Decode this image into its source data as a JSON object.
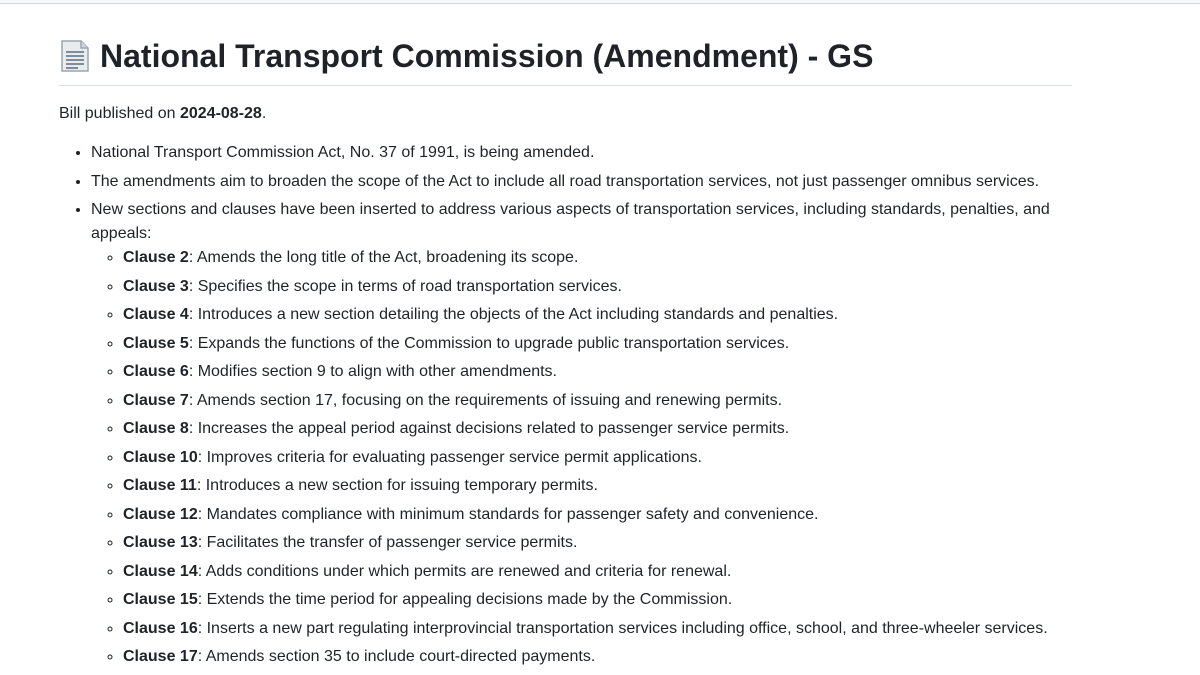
{
  "title": "National Transport Commission (Amendment) - GS",
  "title_icon": "document-icon",
  "published": {
    "prefix": "Bill published on ",
    "date": "2024-08-28",
    "suffix": "."
  },
  "points": [
    "National Transport Commission Act, No. 37 of 1991, is being amended.",
    "The amendments aim to broaden the scope of the Act to include all road transportation services, not just passenger omnibus services.",
    "New sections and clauses have been inserted to address various aspects of transportation services, including standards, penalties, and appeals:"
  ],
  "clauses": [
    {
      "label": "Clause 2",
      "text": ": Amends the long title of the Act, broadening its scope."
    },
    {
      "label": "Clause 3",
      "text": ": Specifies the scope in terms of road transportation services."
    },
    {
      "label": "Clause 4",
      "text": ": Introduces a new section detailing the objects of the Act including standards and penalties."
    },
    {
      "label": "Clause 5",
      "text": ": Expands the functions of the Commission to upgrade public transportation services."
    },
    {
      "label": "Clause 6",
      "text": ": Modifies section 9 to align with other amendments."
    },
    {
      "label": "Clause 7",
      "text": ": Amends section 17, focusing on the requirements of issuing and renewing permits."
    },
    {
      "label": "Clause 8",
      "text": ": Increases the appeal period against decisions related to passenger service permits."
    },
    {
      "label": "Clause 10",
      "text": ": Improves criteria for evaluating passenger service permit applications."
    },
    {
      "label": "Clause 11",
      "text": ": Introduces a new section for issuing temporary permits."
    },
    {
      "label": "Clause 12",
      "text": ": Mandates compliance with minimum standards for passenger safety and convenience."
    },
    {
      "label": "Clause 13",
      "text": ": Facilitates the transfer of passenger service permits."
    },
    {
      "label": "Clause 14",
      "text": ": Adds conditions under which permits are renewed and criteria for renewal."
    },
    {
      "label": "Clause 15",
      "text": ": Extends the time period for appealing decisions made by the Commission."
    },
    {
      "label": "Clause 16",
      "text": ": Inserts a new part regulating interprovincial transportation services including office, school, and three-wheeler services."
    },
    {
      "label": "Clause 17",
      "text": ": Amends section 35 to include court-directed payments."
    }
  ]
}
